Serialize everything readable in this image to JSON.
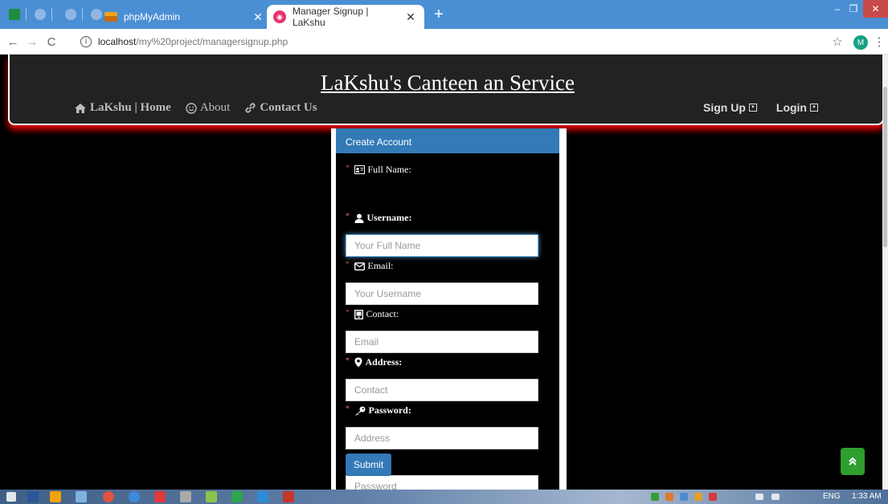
{
  "browser": {
    "tabs": [
      {
        "title": "phpMyAdmin",
        "active": false
      },
      {
        "title": "Manager Signup | LaKshu",
        "active": true
      }
    ],
    "url_host": "localhost",
    "url_path": "/my%20project/managersignup.php",
    "profile_initial": "M"
  },
  "site": {
    "title": "LaKshu's Canteen an Service",
    "nav_left": [
      {
        "label": "LaKshu | Home",
        "icon": "home-icon"
      },
      {
        "label": "About",
        "icon": "smile-icon"
      },
      {
        "label": "Contact Us",
        "icon": "link-icon"
      }
    ],
    "nav_right": [
      {
        "label": "Sign Up",
        "icon": "caret-square-down-icon"
      },
      {
        "label": "Login",
        "icon": "caret-square-down-icon"
      }
    ]
  },
  "form": {
    "heading": "Create Account",
    "fields": [
      {
        "label": "Full Name:",
        "placeholder": "Your Full Name",
        "icon": "id-card-icon",
        "bold": false
      },
      {
        "label": "Username:",
        "placeholder": "Your Username",
        "icon": "user-icon",
        "bold": true
      },
      {
        "label": "Email:",
        "placeholder": "Email",
        "icon": "envelope-icon",
        "bold": false
      },
      {
        "label": "Contact:",
        "placeholder": "Contact",
        "icon": "phone-icon",
        "bold": false
      },
      {
        "label": "Address:",
        "placeholder": "Address",
        "icon": "map-marker-icon",
        "bold": true
      },
      {
        "label": "Password:",
        "placeholder": "Password",
        "icon": "key-icon",
        "bold": true
      }
    ],
    "required_marker": "*",
    "submit_label": "Submit"
  },
  "taskbar": {
    "language": "ENG",
    "time": "1:33 AM"
  },
  "colors": {
    "header_bg": "#222222",
    "header_glow": "#e00000",
    "panel_primary": "#337ab7",
    "back_to_top": "#2e9e2e"
  }
}
